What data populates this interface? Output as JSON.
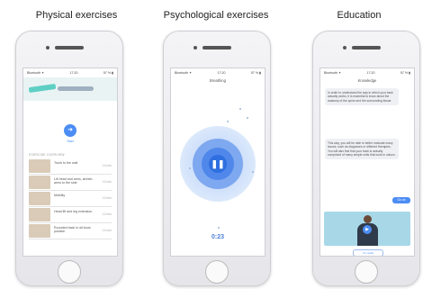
{
  "captions": {
    "physical": "Physical exercises",
    "psychological": "Psychological exercises",
    "education": "Education"
  },
  "phone1": {
    "status": {
      "left": "Bluetooth ✦",
      "time": "17:20",
      "right": "57 % ▮"
    },
    "start_label": "Start",
    "list_heading": "EXERCISE OVERVIEW",
    "exercises": [
      {
        "name": "Trunk to the wall",
        "duration": "10 min"
      },
      {
        "name": "Lift head and arms, stretch arms to the side",
        "duration": "10 min"
      },
      {
        "name": "Mobility",
        "duration": "10 min"
      },
      {
        "name": "Head lift and leg extension",
        "duration": "10 min"
      },
      {
        "name": "Rounded back in all-fours position",
        "duration": "10 min"
      }
    ]
  },
  "phone2": {
    "status": {
      "left": "Bluetooth ✦",
      "time": "17:20",
      "right": "57 % ▮"
    },
    "title": "Breathing",
    "timer": "0:23"
  },
  "phone3": {
    "status": {
      "left": "Bluetooth ✦",
      "time": "17:20",
      "right": "57 % ▮"
    },
    "title": "Knowledge",
    "bubble1": "In order to understand the way in which your back actually works, it is essential to know about the anatomy of the spine and the surrounding tissue.",
    "bubble2": "This way, you will be able to better evaluate many issues, such as diagnoses or different therapies. You will also find that your back is actually comprised of many simple units that work in unison.",
    "reply": "Go on",
    "answer": "I'm ready"
  },
  "colors": {
    "accent": "#4c8df5",
    "breath_dark": "#2f6fe0"
  }
}
